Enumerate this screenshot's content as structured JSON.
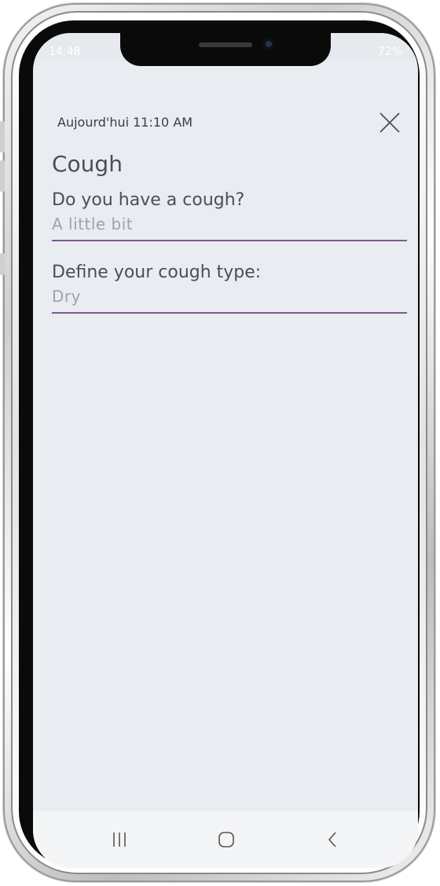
{
  "status_bar": {
    "time": "14:48",
    "battery": "72%"
  },
  "header": {
    "date": "Aujourd'hui 11:10 AM",
    "close_icon": "close-icon"
  },
  "page": {
    "title": "Cough"
  },
  "fields": [
    {
      "label": "Do you have a cough?",
      "value": "A little bit"
    },
    {
      "label": "Define your cough type:",
      "value": "Dry"
    }
  ],
  "nav": {
    "recent_icon": "recent-apps-icon",
    "home_icon": "home-icon",
    "back_icon": "back-icon"
  },
  "colors": {
    "screen_bg": "#e9edf2",
    "underline": "#7a5a8e",
    "text": "#4a4f55",
    "value_text": "#9ea3a9"
  }
}
